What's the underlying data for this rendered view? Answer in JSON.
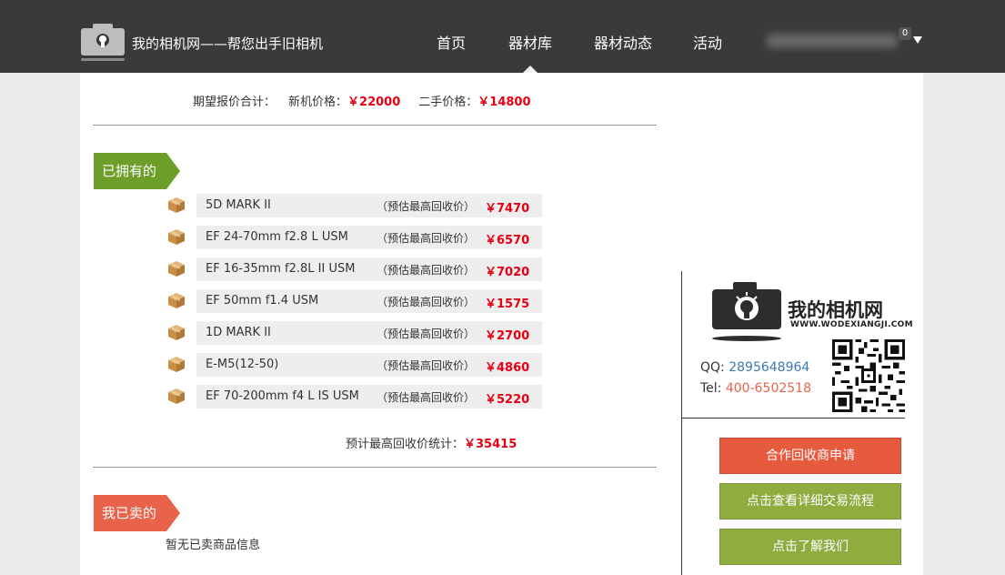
{
  "header": {
    "site_title": "我的相机网——帮您出手旧相机",
    "nav": [
      {
        "label": "首页"
      },
      {
        "label": "器材库",
        "active": true
      },
      {
        "label": "器材动态"
      },
      {
        "label": "活动"
      }
    ],
    "user_badge_count": "0"
  },
  "summary": {
    "label": "期望报价合计：",
    "new_label": "新机价格：",
    "new_value": "￥22000",
    "used_label": "二手价格：",
    "used_value": "￥14800"
  },
  "owned": {
    "tag": "已拥有的",
    "hint": "（预估最高回收价）",
    "items": [
      {
        "name": "5D MARK II",
        "price": "￥7470"
      },
      {
        "name": "EF 24-70mm f2.8 L USM",
        "price": "￥6570"
      },
      {
        "name": "EF 16-35mm f2.8L II USM",
        "price": "￥7020"
      },
      {
        "name": "EF 50mm f1.4 USM",
        "price": "￥1575"
      },
      {
        "name": "1D MARK II",
        "price": "￥2700"
      },
      {
        "name": "E-M5(12-50)",
        "price": "￥4860"
      },
      {
        "name": "EF 70-200mm f4 L IS USM",
        "price": "￥5220"
      }
    ],
    "total_label": "预计最高回收价统计：",
    "total_value": "￥35415"
  },
  "sold": {
    "tag": "我已卖的",
    "empty_message": "暂无已卖商品信息"
  },
  "sidebar": {
    "brand_name": "我的相机网",
    "brand_url": "WWW.WODEXIANGJI.COM",
    "qq_label": "QQ:",
    "qq_value": "2895648964",
    "tel_label": "Tel:",
    "tel_value": "400-6502518",
    "buttons": [
      {
        "label": "合作回收商申请"
      },
      {
        "label": "点击查看详细交易流程"
      },
      {
        "label": "点击了解我们"
      }
    ]
  },
  "colors": {
    "price_red": "#e60012",
    "tag_green": "#6e9e2a",
    "tag_orange": "#e8634a",
    "btn_red": "#e65a3e",
    "btn_green": "#8fac3f",
    "nav_bg": "#3a3a3a"
  }
}
